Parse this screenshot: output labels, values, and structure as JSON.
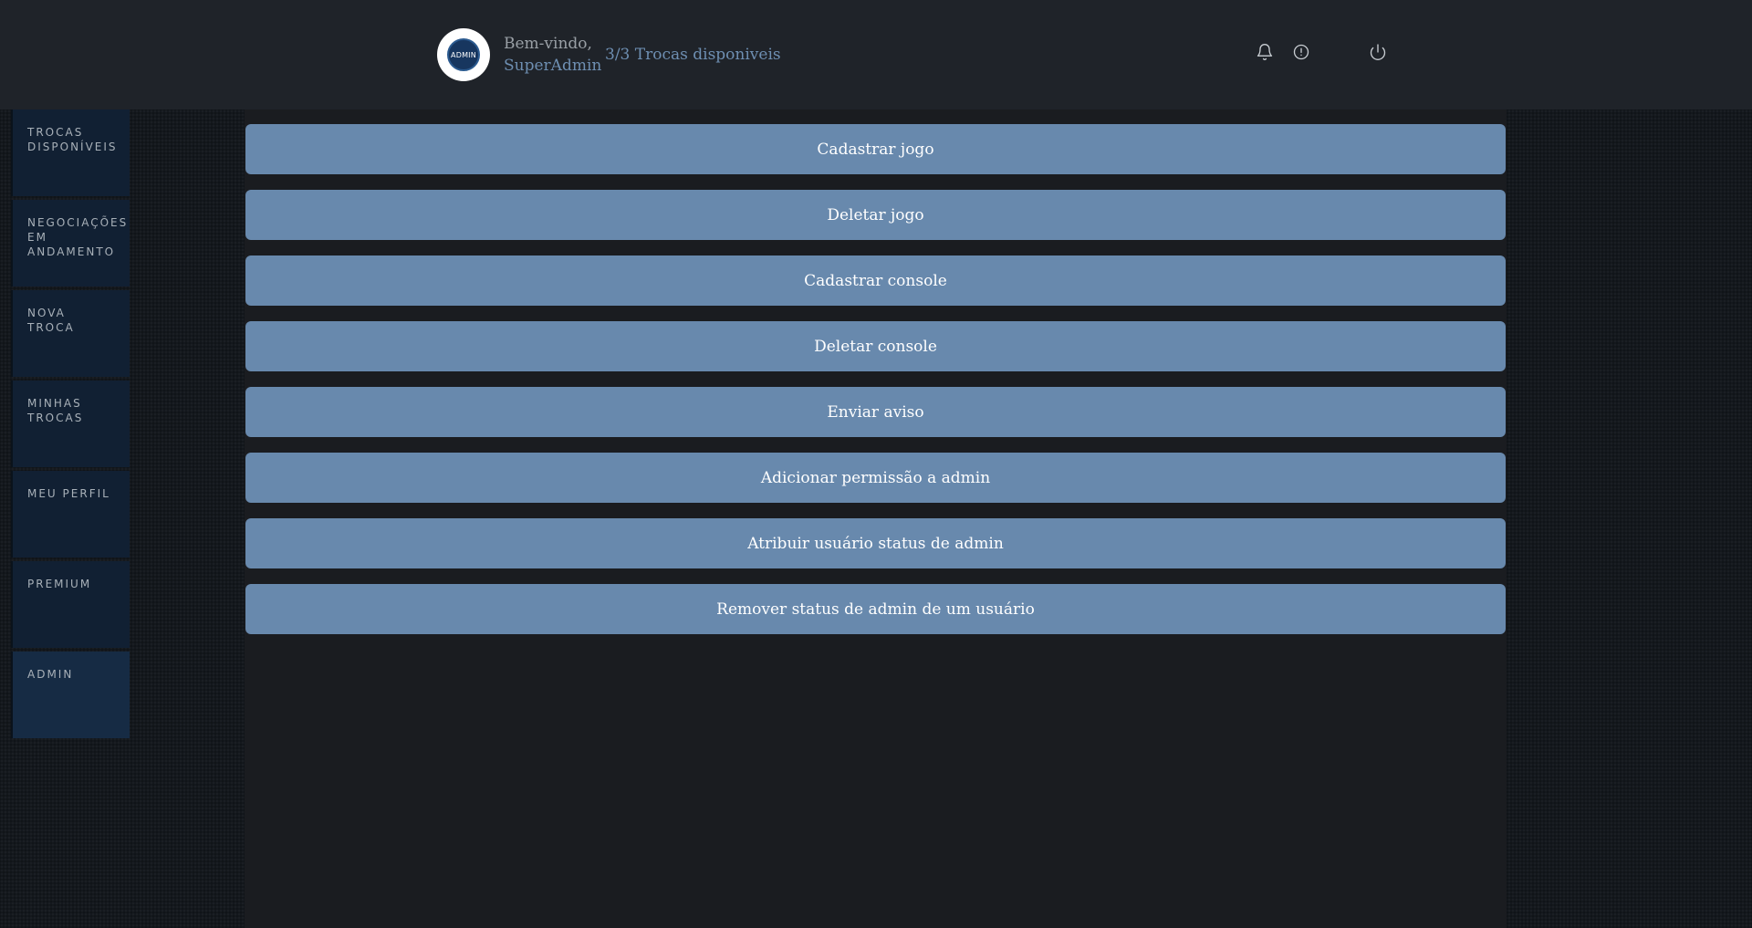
{
  "header": {
    "avatar_text": "ADMIN",
    "greeting": "Bem-vindo,",
    "username": "SuperAdmin",
    "trades_available": "3/3 Trocas disponiveis",
    "icons": [
      "bell-icon",
      "alert-circle-icon",
      "power-icon"
    ]
  },
  "sidebar": {
    "items": [
      {
        "label": "TROCAS\nDISPONÍVEIS"
      },
      {
        "label": "NEGOCIAÇÕES\nEM\nANDAMENTO"
      },
      {
        "label": "NOVA\nTROCA"
      },
      {
        "label": "MINHAS\nTROCAS"
      },
      {
        "label": "MEU PERFIL"
      },
      {
        "label": "PREMIUM"
      },
      {
        "label": "ADMIN"
      }
    ],
    "active": "ADMIN"
  },
  "actions": [
    {
      "label": "Cadastrar jogo"
    },
    {
      "label": "Deletar jogo"
    },
    {
      "label": "Cadastrar console"
    },
    {
      "label": "Deletar console"
    },
    {
      "label": "Enviar aviso"
    },
    {
      "label": "Adicionar permissão a admin"
    },
    {
      "label": "Atribuir usuário status de admin"
    },
    {
      "label": "Remover status de admin de um usuário"
    }
  ],
  "colors": {
    "header_bg": "#1f2329",
    "accent_link": "#6e8fb2",
    "button_bg": "#6889ad",
    "sidebar_bg": "#112033",
    "main_bg": "#1a1c20"
  }
}
